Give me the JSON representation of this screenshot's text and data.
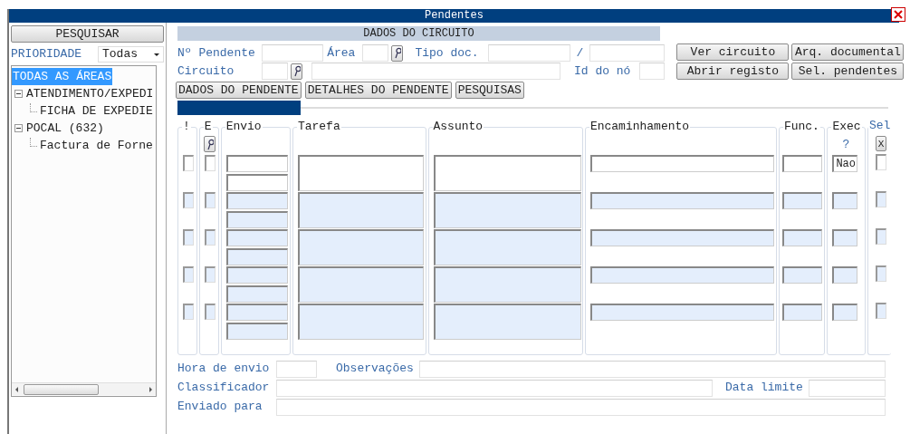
{
  "window": {
    "title": "Pendentes"
  },
  "sidebar": {
    "search_button": "PESQUISAR",
    "priority": {
      "label": "PRIORIDADE",
      "value": "Todas"
    },
    "tree": [
      {
        "label": "TODAS AS ÁREAS",
        "selected": true
      },
      {
        "label": "ATENDIMENTO/EXPEDI",
        "selected": false,
        "expanded": true,
        "children": [
          {
            "label": "FICHA DE EXPEDIE",
            "selected": false
          }
        ]
      },
      {
        "label": "POCAL (632)",
        "selected": false,
        "expanded": true,
        "children": [
          {
            "label": "Factura de Forne",
            "selected": false
          }
        ]
      }
    ]
  },
  "circuit": {
    "header": "DADOS DO CIRCUITO",
    "pendente_label": "Nº Pendente",
    "area_label": "Área",
    "tipo_doc_label": "Tipo doc.",
    "separator": "/",
    "circuito_label": "Circuito",
    "id_no_label": "Id do nó",
    "buttons": [
      "Ver circuito",
      "Arq. documental",
      "Abrir registo",
      "Sel. pendentes"
    ]
  },
  "tabs": [
    {
      "label": "DADOS DO PENDENTE",
      "selected": false
    },
    {
      "label": "DETALHES DO PENDENTE",
      "selected": false
    },
    {
      "label": "PESQUISAS",
      "selected": false
    }
  ],
  "table": {
    "columns": [
      {
        "label": "!",
        "kind": "label"
      },
      {
        "label": "E",
        "kind": "label"
      },
      {
        "label": "Envio",
        "kind": "label"
      },
      {
        "label": "Tarefa",
        "kind": "label"
      },
      {
        "label": "Assunto",
        "kind": "label"
      },
      {
        "label": "Encaminhamento",
        "kind": "label"
      },
      {
        "label": "Func.",
        "kind": "label"
      },
      {
        "label": "Exec",
        "kind": "label"
      },
      {
        "label": "Sel",
        "kind": "link"
      }
    ],
    "exec_hint": "?",
    "select_all_button": "X",
    "rows": [
      {
        "active": true,
        "flag": false,
        "e": false,
        "exec": "Nao",
        "sel": false
      },
      {
        "active": false,
        "flag": false,
        "e": false,
        "sel": false
      },
      {
        "active": false,
        "flag": false,
        "e": false,
        "sel": false
      },
      {
        "active": false,
        "flag": false,
        "e": false,
        "sel": false
      },
      {
        "active": false,
        "flag": false,
        "e": false,
        "sel": false
      }
    ]
  },
  "details": {
    "hora_label": "Hora de envio",
    "observacoes_label": "Observações",
    "classificador_label": "Classificador",
    "data_limite_label": "Data limite",
    "enviado_label": "Enviado para"
  }
}
